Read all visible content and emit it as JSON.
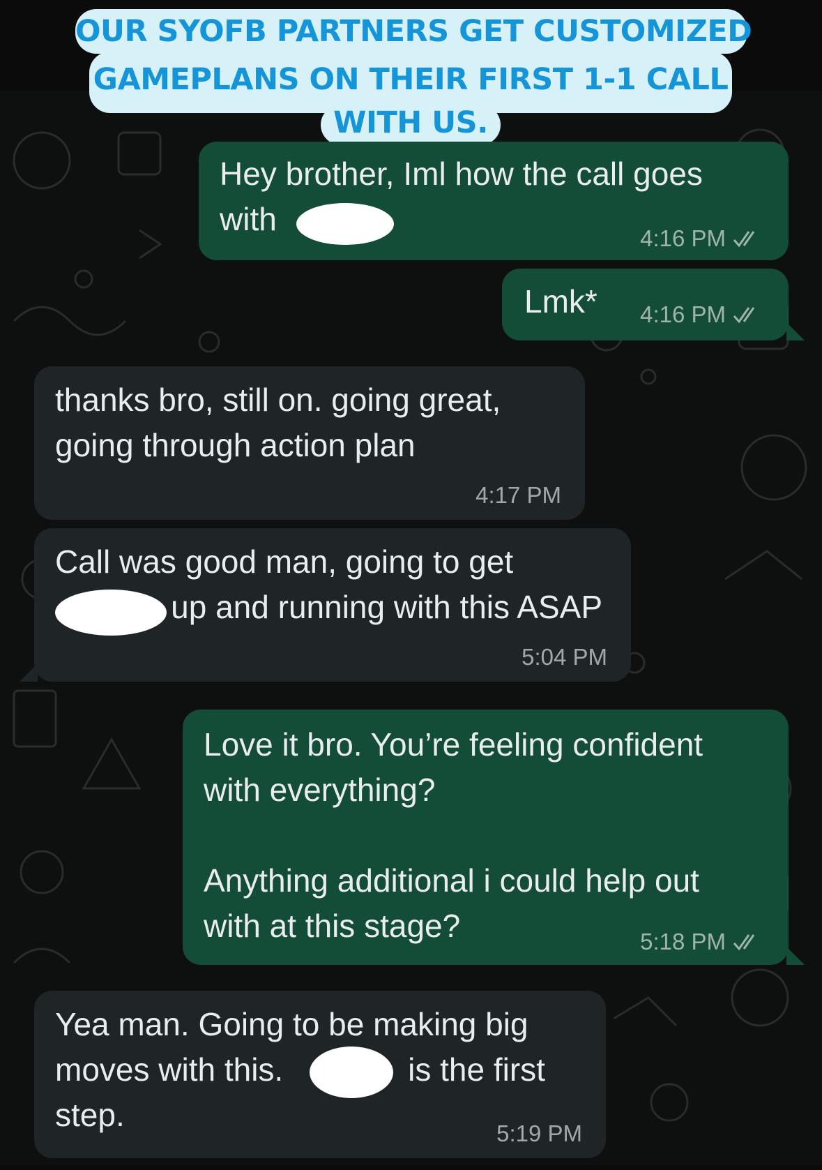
{
  "caption": {
    "line1": "OUR SYOFB PARTNERS GET CUSTOMIZED",
    "line2": "GAMEPLANS ON THEIR FIRST 1-1 CALL",
    "line3": "WITH US."
  },
  "colors": {
    "outgoing_bubble": "#144d37",
    "incoming_bubble": "#1f2426",
    "caption_bg": "#d6f1f7",
    "caption_text": "#1594d8",
    "read_check": "#9fb5ac"
  },
  "messages": [
    {
      "direction": "outgoing",
      "text": "Hey brother, Iml how the call goes\nwith",
      "time": "4:16 PM",
      "status": "read-double-check-icon"
    },
    {
      "direction": "outgoing",
      "text": "Lmk*",
      "time": "4:16 PM",
      "status": "read-double-check-icon"
    },
    {
      "direction": "incoming",
      "text": "thanks bro, still on. going great,\ngoing through action plan",
      "time": "4:17 PM"
    },
    {
      "direction": "incoming",
      "text": "Call was good man, going to get\n             up and running with this ASAP",
      "time": "5:04 PM"
    },
    {
      "direction": "outgoing",
      "text": "Love it bro. You’re feeling confident\nwith everything?\n\nAnything additional i could help out\nwith at this stage?",
      "time": "5:18 PM",
      "status": "read-double-check-icon"
    },
    {
      "direction": "incoming",
      "text": "Yea man. Going to be making big\nmoves with this.              is the first\nstep.",
      "time": "5:19 PM"
    }
  ]
}
